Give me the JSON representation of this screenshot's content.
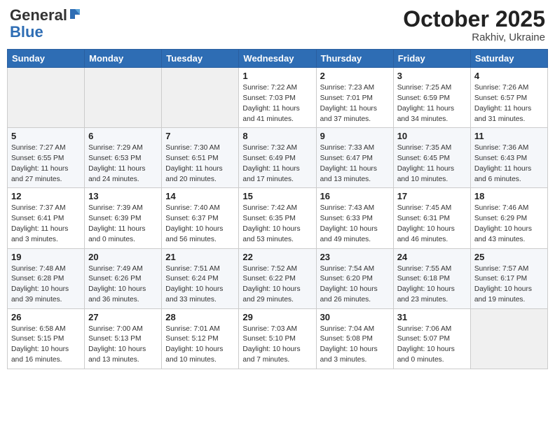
{
  "logo": {
    "general": "General",
    "blue": "Blue"
  },
  "header": {
    "month": "October 2025",
    "location": "Rakhiv, Ukraine"
  },
  "weekdays": [
    "Sunday",
    "Monday",
    "Tuesday",
    "Wednesday",
    "Thursday",
    "Friday",
    "Saturday"
  ],
  "weeks": [
    [
      {
        "day": "",
        "info": ""
      },
      {
        "day": "",
        "info": ""
      },
      {
        "day": "",
        "info": ""
      },
      {
        "day": "1",
        "info": "Sunrise: 7:22 AM\nSunset: 7:03 PM\nDaylight: 11 hours\nand 41 minutes."
      },
      {
        "day": "2",
        "info": "Sunrise: 7:23 AM\nSunset: 7:01 PM\nDaylight: 11 hours\nand 37 minutes."
      },
      {
        "day": "3",
        "info": "Sunrise: 7:25 AM\nSunset: 6:59 PM\nDaylight: 11 hours\nand 34 minutes."
      },
      {
        "day": "4",
        "info": "Sunrise: 7:26 AM\nSunset: 6:57 PM\nDaylight: 11 hours\nand 31 minutes."
      }
    ],
    [
      {
        "day": "5",
        "info": "Sunrise: 7:27 AM\nSunset: 6:55 PM\nDaylight: 11 hours\nand 27 minutes."
      },
      {
        "day": "6",
        "info": "Sunrise: 7:29 AM\nSunset: 6:53 PM\nDaylight: 11 hours\nand 24 minutes."
      },
      {
        "day": "7",
        "info": "Sunrise: 7:30 AM\nSunset: 6:51 PM\nDaylight: 11 hours\nand 20 minutes."
      },
      {
        "day": "8",
        "info": "Sunrise: 7:32 AM\nSunset: 6:49 PM\nDaylight: 11 hours\nand 17 minutes."
      },
      {
        "day": "9",
        "info": "Sunrise: 7:33 AM\nSunset: 6:47 PM\nDaylight: 11 hours\nand 13 minutes."
      },
      {
        "day": "10",
        "info": "Sunrise: 7:35 AM\nSunset: 6:45 PM\nDaylight: 11 hours\nand 10 minutes."
      },
      {
        "day": "11",
        "info": "Sunrise: 7:36 AM\nSunset: 6:43 PM\nDaylight: 11 hours\nand 6 minutes."
      }
    ],
    [
      {
        "day": "12",
        "info": "Sunrise: 7:37 AM\nSunset: 6:41 PM\nDaylight: 11 hours\nand 3 minutes."
      },
      {
        "day": "13",
        "info": "Sunrise: 7:39 AM\nSunset: 6:39 PM\nDaylight: 11 hours\nand 0 minutes."
      },
      {
        "day": "14",
        "info": "Sunrise: 7:40 AM\nSunset: 6:37 PM\nDaylight: 10 hours\nand 56 minutes."
      },
      {
        "day": "15",
        "info": "Sunrise: 7:42 AM\nSunset: 6:35 PM\nDaylight: 10 hours\nand 53 minutes."
      },
      {
        "day": "16",
        "info": "Sunrise: 7:43 AM\nSunset: 6:33 PM\nDaylight: 10 hours\nand 49 minutes."
      },
      {
        "day": "17",
        "info": "Sunrise: 7:45 AM\nSunset: 6:31 PM\nDaylight: 10 hours\nand 46 minutes."
      },
      {
        "day": "18",
        "info": "Sunrise: 7:46 AM\nSunset: 6:29 PM\nDaylight: 10 hours\nand 43 minutes."
      }
    ],
    [
      {
        "day": "19",
        "info": "Sunrise: 7:48 AM\nSunset: 6:28 PM\nDaylight: 10 hours\nand 39 minutes."
      },
      {
        "day": "20",
        "info": "Sunrise: 7:49 AM\nSunset: 6:26 PM\nDaylight: 10 hours\nand 36 minutes."
      },
      {
        "day": "21",
        "info": "Sunrise: 7:51 AM\nSunset: 6:24 PM\nDaylight: 10 hours\nand 33 minutes."
      },
      {
        "day": "22",
        "info": "Sunrise: 7:52 AM\nSunset: 6:22 PM\nDaylight: 10 hours\nand 29 minutes."
      },
      {
        "day": "23",
        "info": "Sunrise: 7:54 AM\nSunset: 6:20 PM\nDaylight: 10 hours\nand 26 minutes."
      },
      {
        "day": "24",
        "info": "Sunrise: 7:55 AM\nSunset: 6:18 PM\nDaylight: 10 hours\nand 23 minutes."
      },
      {
        "day": "25",
        "info": "Sunrise: 7:57 AM\nSunset: 6:17 PM\nDaylight: 10 hours\nand 19 minutes."
      }
    ],
    [
      {
        "day": "26",
        "info": "Sunrise: 6:58 AM\nSunset: 5:15 PM\nDaylight: 10 hours\nand 16 minutes."
      },
      {
        "day": "27",
        "info": "Sunrise: 7:00 AM\nSunset: 5:13 PM\nDaylight: 10 hours\nand 13 minutes."
      },
      {
        "day": "28",
        "info": "Sunrise: 7:01 AM\nSunset: 5:12 PM\nDaylight: 10 hours\nand 10 minutes."
      },
      {
        "day": "29",
        "info": "Sunrise: 7:03 AM\nSunset: 5:10 PM\nDaylight: 10 hours\nand 7 minutes."
      },
      {
        "day": "30",
        "info": "Sunrise: 7:04 AM\nSunset: 5:08 PM\nDaylight: 10 hours\nand 3 minutes."
      },
      {
        "day": "31",
        "info": "Sunrise: 7:06 AM\nSunset: 5:07 PM\nDaylight: 10 hours\nand 0 minutes."
      },
      {
        "day": "",
        "info": ""
      }
    ]
  ]
}
